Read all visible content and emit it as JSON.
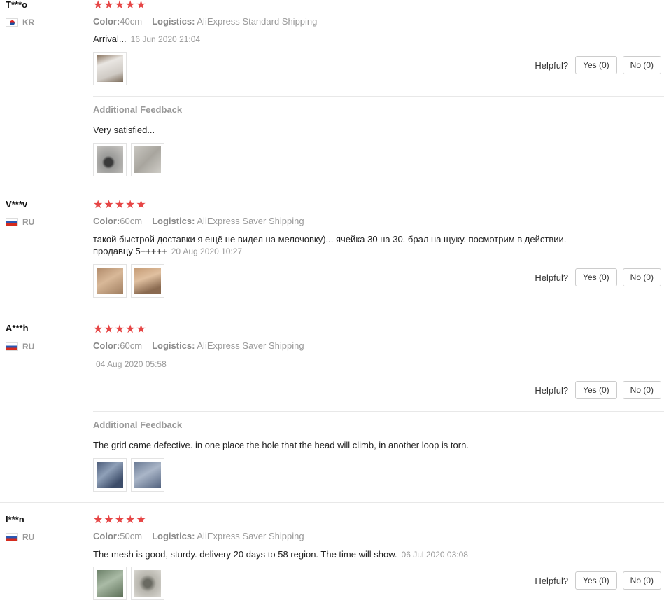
{
  "labels": {
    "color": "Color:",
    "logistics": "Logistics:",
    "helpful": "Helpful?",
    "additional_feedback": "Additional Feedback"
  },
  "rating_stars": "★★★★★",
  "reviews": [
    {
      "user": "T***o",
      "country": "KR",
      "rating": 5,
      "color_value": "40cm",
      "logistics_value": "AliExpress Standard Shipping",
      "text": "Arrival...",
      "date": "16 Jun 2020 21:04",
      "yes": "Yes (0)",
      "no": "No (0)",
      "additional_text": "Very satisfied..."
    },
    {
      "user": "V***v",
      "country": "RU",
      "rating": 5,
      "color_value": "60cm",
      "logistics_value": "AliExpress Saver Shipping",
      "text_line1": "такой быстрой доставки я ещё не видел на мелочовку)... ячейка 30 на 30. брал на щуку. посмотрим в действии.",
      "text_line2": "продавцу 5+++++",
      "date": "20 Aug 2020 10:27",
      "yes": "Yes (0)",
      "no": "No (0)"
    },
    {
      "user": "A***h",
      "country": "RU",
      "rating": 5,
      "color_value": "60cm",
      "logistics_value": "AliExpress Saver Shipping",
      "date": "04 Aug 2020 05:58",
      "yes": "Yes (0)",
      "no": "No (0)",
      "additional_text": "The grid came defective. in one place the hole that the head will climb, in another loop is torn."
    },
    {
      "user": "I***n",
      "country": "RU",
      "rating": 5,
      "color_value": "50cm",
      "logistics_value": "AliExpress Saver Shipping",
      "text": "The mesh is good, sturdy. delivery 20 days to 58 region. The time will show.",
      "date": "06 Jul 2020 03:08",
      "yes": "Yes (0)",
      "no": "No (0)"
    }
  ]
}
